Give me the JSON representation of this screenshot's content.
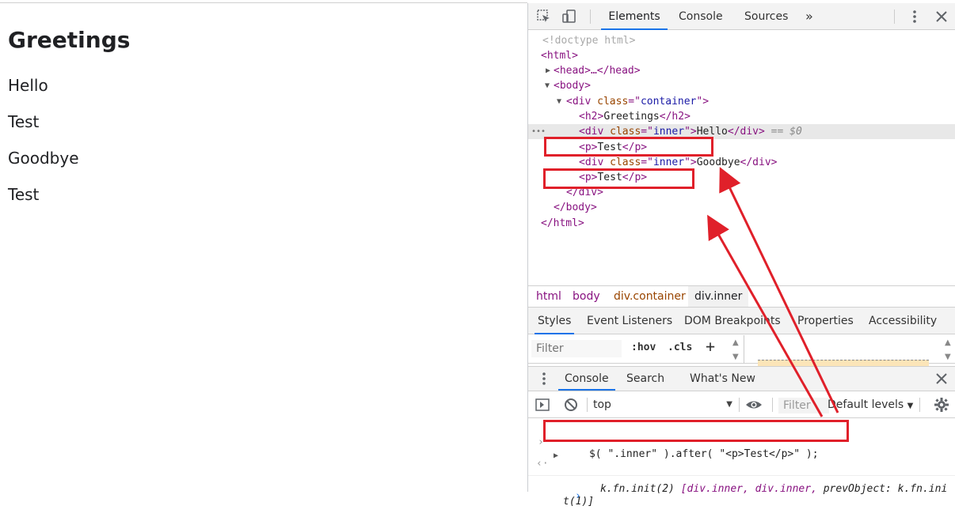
{
  "page": {
    "heading": "Greetings",
    "lines": [
      "Hello",
      "Test",
      "Goodbye",
      "Test"
    ]
  },
  "devtools": {
    "tabs": [
      "Elements",
      "Console",
      "Sources"
    ],
    "more_tabs": "»",
    "elements_tree": {
      "doctype": "<!doctype html>",
      "html_open": "<html>",
      "head": "<head>…</head>",
      "body_open": "<body>",
      "div_container_open": {
        "tag_start": "<div ",
        "attr": "class",
        "eq": "=\"",
        "val": "container",
        "end": "\">"
      },
      "h2": {
        "open": "<h2>",
        "text": "Greetings",
        "close": "</h2>"
      },
      "div_inner_1": {
        "tag_start": "<div ",
        "attr": "class",
        "eq": "=\"",
        "val": "inner",
        "end": "\">",
        "text": "Hello",
        "close": "</div>",
        "marker": " == $0"
      },
      "p_1": {
        "open": "<p>",
        "text": "Test",
        "close": "</p>"
      },
      "div_inner_2": {
        "tag_start": "<div ",
        "attr": "class",
        "eq": "=\"",
        "val": "inner",
        "end": "\">",
        "text": "Goodbye",
        "close": "</div>"
      },
      "p_2": {
        "open": "<p>",
        "text": "Test",
        "close": "</p>"
      },
      "div_close": "</div>",
      "body_close": "</body>",
      "html_close": "</html>"
    },
    "selected_dots": "•••",
    "breadcrumbs": [
      "html",
      "body",
      "div.container",
      "div.inner"
    ],
    "styles_tabs": [
      "Styles",
      "Event Listeners",
      "DOM Breakpoints",
      "Properties",
      "Accessibility"
    ],
    "styles_filter_placeholder": "Filter",
    "hov_label": ":hov",
    "cls_label": ".cls",
    "add_rule": "+",
    "drawer_tabs": [
      "Console",
      "Search",
      "What's New"
    ],
    "console_context": "top",
    "console_filter_placeholder": "Filter",
    "default_levels": "Default levels",
    "console_input": "$( \".inner\" ).after( \"<p>Test</p>\" );",
    "console_result_1": "k.fn.init(2) ",
    "console_result_2": "[div.inner, div.inner, ",
    "console_result_3": "prevObject: k.fn.ini",
    "console_result_4": "t(1)]",
    "input_prompt": "›",
    "output_prompt": "‹·",
    "bottom_prompt": "›"
  },
  "colors": {
    "annotation_red": "#e0202a",
    "tab_accent": "#1a73e8",
    "tag": "#881280",
    "attr": "#994500",
    "attr_value": "#1a1aa6"
  }
}
